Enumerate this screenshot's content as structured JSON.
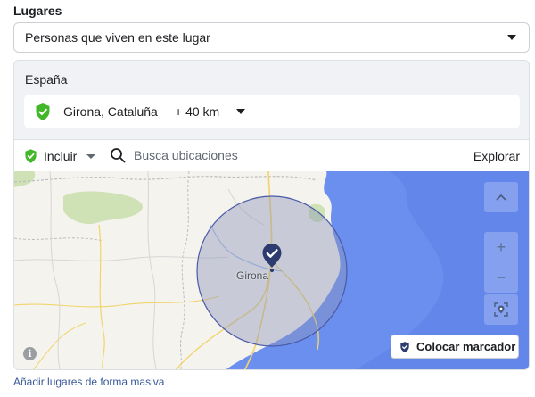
{
  "section": {
    "title": "Lugares"
  },
  "audience_select": {
    "value": "Personas que viven en este lugar"
  },
  "country": "España",
  "location": {
    "name": "Girona, Cataluña",
    "radius": "+ 40 km"
  },
  "toolbar": {
    "include_label": "Incluir",
    "search_placeholder": "Busca ubicaciones",
    "explore_label": "Explorar"
  },
  "map": {
    "city_label": "Girona",
    "place_marker_label": "Colocar marcador",
    "info_glyph": "i",
    "controls": {
      "up": "^",
      "zoom_in": "+",
      "zoom_out": "−"
    }
  },
  "footer": {
    "bulk_link": "Añadir lugares de forma masiva"
  },
  "colors": {
    "include_green": "#42b72a",
    "marker_navy": "#2d3b6e",
    "sea_blue": "#6b8fef",
    "radius_fill": "#8a93b8",
    "link_blue": "#385898"
  }
}
